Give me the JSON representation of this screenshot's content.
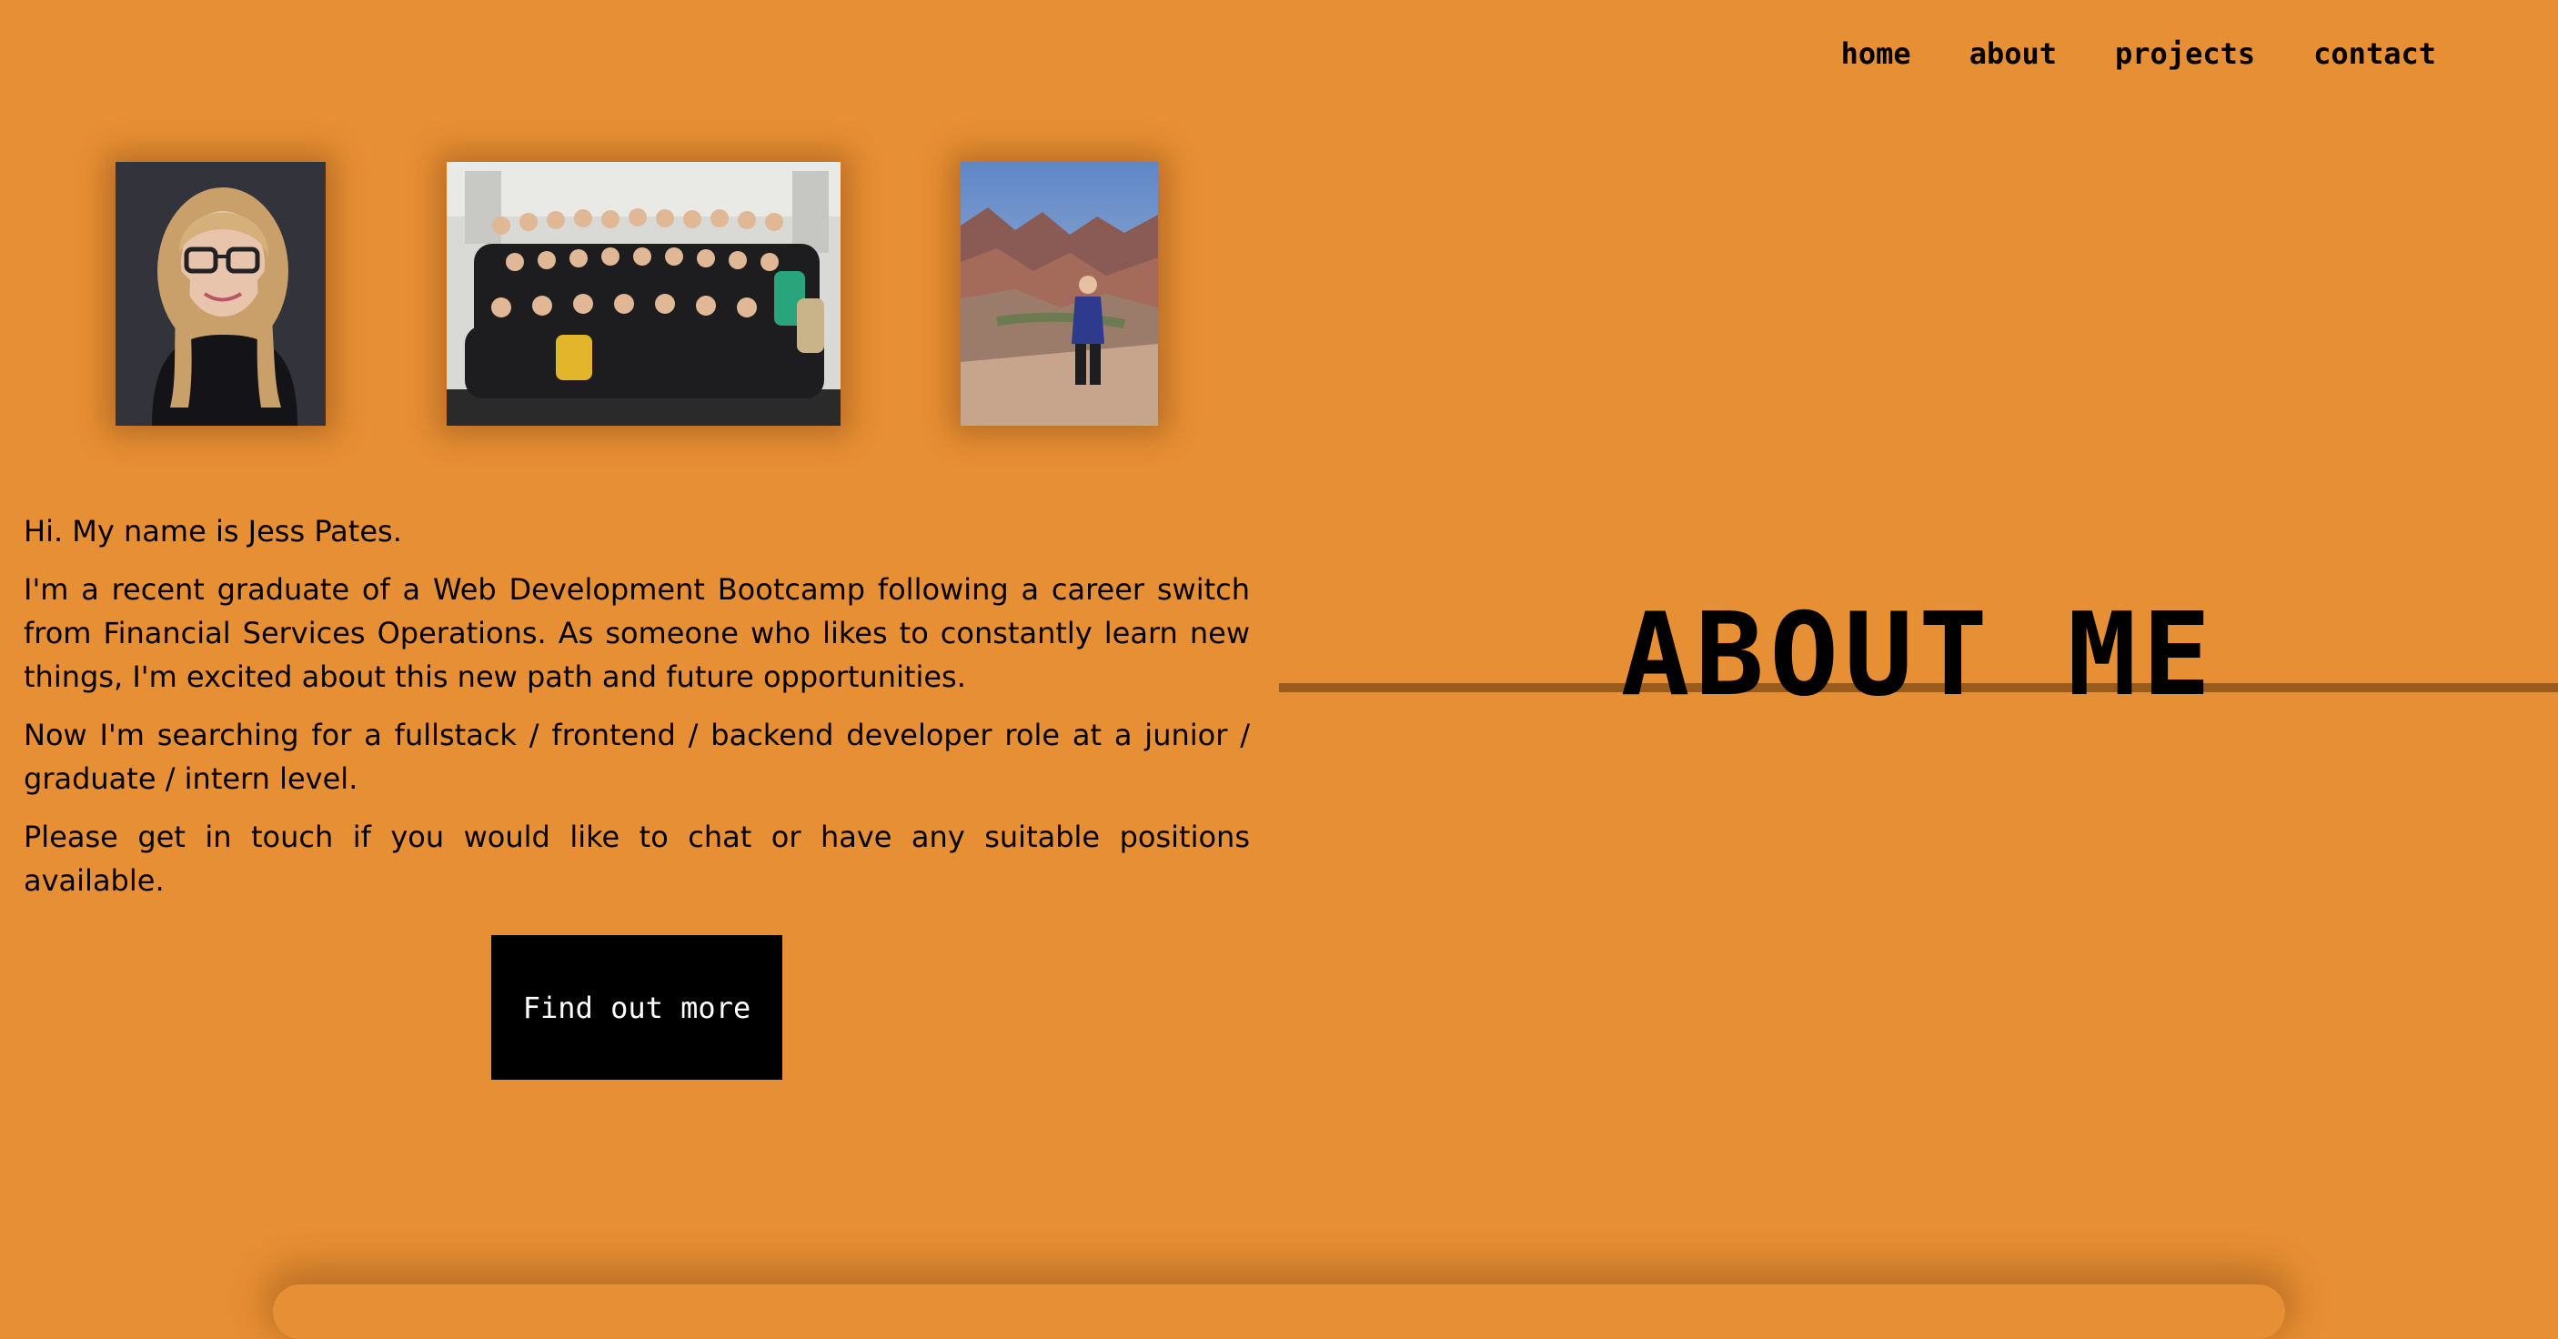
{
  "nav": {
    "items": [
      {
        "label": "home"
      },
      {
        "label": "about"
      },
      {
        "label": "projects"
      },
      {
        "label": "contact"
      }
    ]
  },
  "photos": [
    {
      "icon": "portrait-photo"
    },
    {
      "icon": "group-photo"
    },
    {
      "icon": "hiking-photo"
    }
  ],
  "intro": {
    "paragraphs": [
      "Hi. My name is Jess Pates.",
      "I'm a recent graduate of a Web Development Bootcamp following a career switch from Financial Services Operations. As someone who likes to constantly learn new things, I'm excited about this new path and future opportunities.",
      "Now I'm searching for a fullstack / frontend / backend developer role at a junior / graduate / intern level.",
      "Please get in touch if you would like to chat or have any suitable positions available."
    ]
  },
  "cta": {
    "label": "Find out more"
  },
  "section": {
    "title": "ABOUT ME"
  },
  "colors": {
    "background": "#E78F34",
    "button": "#000000",
    "button_text": "#FFFFFF"
  }
}
